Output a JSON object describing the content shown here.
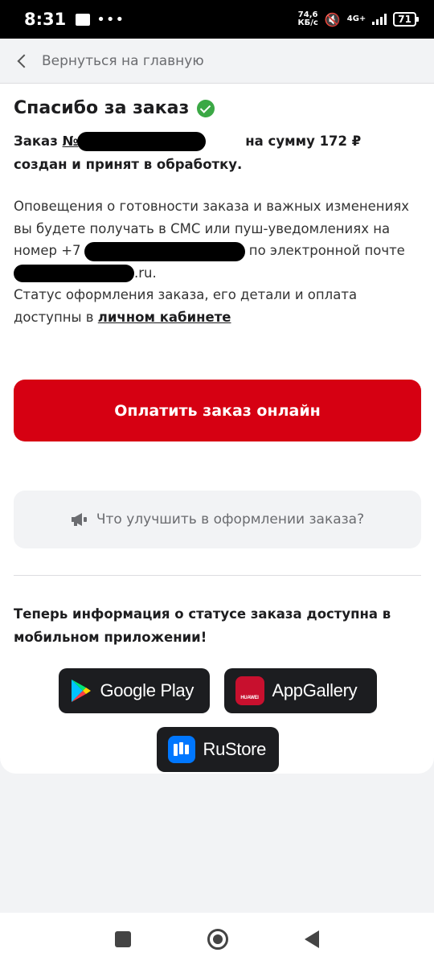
{
  "status_bar": {
    "time": "8:31",
    "dots": "•••",
    "speed_value": "74,6",
    "speed_unit": "КБ/с",
    "network": "4G+",
    "battery": "71"
  },
  "header": {
    "back_label": "Вернуться на главную"
  },
  "order": {
    "title": "Спасибо за заказ",
    "prefix": "Заказ ",
    "number_visible": "№",
    "sum_text": " на сумму 172 ₽",
    "created_text": "создан и принят в обработку."
  },
  "notice": {
    "line1": "Оповещения о готовности заказа и важных изменениях вы будете получать в СМС или пуш-уведомлениях на номер +7",
    "line2": " по электронной почте ",
    "mail_suffix": ".ru.",
    "line3": "Статус оформления заказа, его детали и оплата доступны в ",
    "link": "личном кабинете"
  },
  "pay_button": {
    "label": "Оплатить заказ онлайн"
  },
  "feedback": {
    "label": "Что улучшить в оформлении заказа?"
  },
  "app_promo": {
    "text": "Теперь информация о статусе заказа доступна в мобильном приложении!",
    "stores": {
      "google_play": "Google Play",
      "app_gallery": "AppGallery",
      "huawei_mark": "HUAWEI",
      "rustore": "RuStore"
    }
  },
  "colors": {
    "accent_red": "#d60012",
    "success_green": "#3ba845",
    "store_button_bg": "#1c1d20"
  }
}
